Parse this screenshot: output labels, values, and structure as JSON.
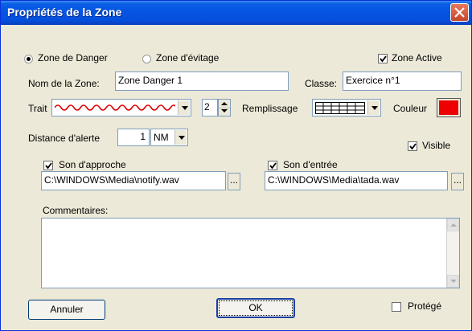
{
  "window": {
    "title": "Propriétés de la Zone"
  },
  "zone_type": {
    "danger_label": "Zone de Danger",
    "avoid_label": "Zone d'évitage",
    "selected": "danger"
  },
  "active": {
    "label": "Zone Active",
    "checked": true
  },
  "name": {
    "label": "Nom de la Zone:",
    "value": "Zone Danger 1"
  },
  "class": {
    "label": "Classe:",
    "value": "Exercice n°1"
  },
  "trait": {
    "label": "Trait",
    "width_value": "2",
    "line_color": "#e00000"
  },
  "fill": {
    "label": "Remplissage"
  },
  "color": {
    "label": "Couleur",
    "value": "#ee0000"
  },
  "alert": {
    "label": "Distance d'alerte",
    "value": "1",
    "unit": "NM"
  },
  "visible": {
    "label": "Visible",
    "checked": true
  },
  "approach_sound": {
    "label": "Son d'approche",
    "checked": true,
    "path": "C:\\WINDOWS\\Media\\notify.wav",
    "browse": "..."
  },
  "entry_sound": {
    "label": "Son d'entrée",
    "checked": true,
    "path": "C:\\WINDOWS\\Media\\tada.wav",
    "browse": "..."
  },
  "comments": {
    "label": "Commentaires:",
    "value": ""
  },
  "buttons": {
    "cancel": "Annuler",
    "ok": "OK"
  },
  "protected": {
    "label": "Protégé",
    "checked": false
  }
}
